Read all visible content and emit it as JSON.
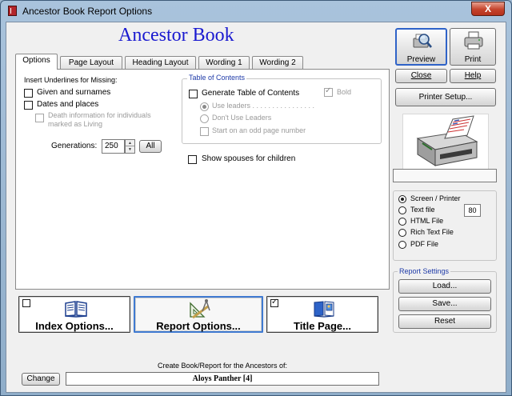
{
  "window": {
    "title": "Ancestor Book Report Options",
    "close_glyph": "X"
  },
  "app_title": "Ancestor Book",
  "tabs": [
    {
      "label": "Options",
      "active": true
    },
    {
      "label": "Page Layout",
      "active": false
    },
    {
      "label": "Heading Layout",
      "active": false
    },
    {
      "label": "Wording 1",
      "active": false
    },
    {
      "label": "Wording 2",
      "active": false
    }
  ],
  "underlines": {
    "heading": "Insert Underlines for Missing:",
    "given_surnames": "Given and surnames",
    "dates_places": "Dates and places",
    "death_info_line1": "Death information for individuals",
    "death_info_line2": "marked as Living"
  },
  "generations": {
    "label": "Generations:",
    "value": "250",
    "all_label": "All"
  },
  "toc": {
    "title": "Table of Contents",
    "generate": "Generate Table of Contents",
    "bold": "Bold",
    "use_leaders": "Use leaders . . . . . . . . . . . . . . . .",
    "dont_use_leaders": "Don't Use Leaders",
    "odd_page": "Start on an odd page number"
  },
  "spouses_label": "Show spouses for children",
  "option_buttons": {
    "index": "Index Options...",
    "report": "Report Options...",
    "title_page": "Title Page..."
  },
  "right_panel": {
    "preview": "Preview",
    "print": "Print",
    "close": "Close",
    "help": "Help",
    "printer_setup": "Printer Setup..."
  },
  "output": {
    "screen_printer": "Screen / Printer",
    "text_file": "Text file",
    "text_width": "80",
    "html_file": "HTML File",
    "rtf_file": "Rich Text File",
    "pdf_file": "PDF File"
  },
  "report_settings": {
    "title": "Report Settings",
    "load": "Load...",
    "save": "Save...",
    "reset": "Reset"
  },
  "footer": {
    "label": "Create Book/Report for the Ancestors of:",
    "change": "Change",
    "ancestor": "Aloys Panther [4]"
  }
}
